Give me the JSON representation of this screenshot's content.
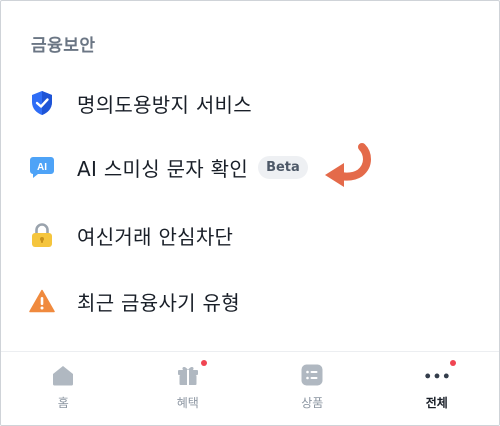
{
  "section": {
    "title": "금융보안"
  },
  "menu": [
    {
      "label": "명의도용방지 서비스",
      "icon": "shield-icon"
    },
    {
      "label": "AI 스미싱 문자 확인",
      "icon": "ai-chat-icon",
      "badge": "Beta",
      "icon_text": "AI"
    },
    {
      "label": "여신거래 안심차단",
      "icon": "lock-icon"
    },
    {
      "label": "최근 금융사기 유형",
      "icon": "warning-icon"
    }
  ],
  "tabs": [
    {
      "label": "홈",
      "icon": "home-icon",
      "active": false,
      "notification": false
    },
    {
      "label": "혜택",
      "icon": "gift-icon",
      "active": false,
      "notification": true
    },
    {
      "label": "상품",
      "icon": "products-icon",
      "active": false,
      "notification": false
    },
    {
      "label": "전체",
      "icon": "more-icon",
      "active": true,
      "notification": true
    }
  ],
  "colors": {
    "shield": "#2f6df6",
    "ai": "#4ea3f7",
    "lock": "#f5c53d",
    "warning": "#f08a3e",
    "arrow": "#e46a4a",
    "notification": "#f04452"
  }
}
